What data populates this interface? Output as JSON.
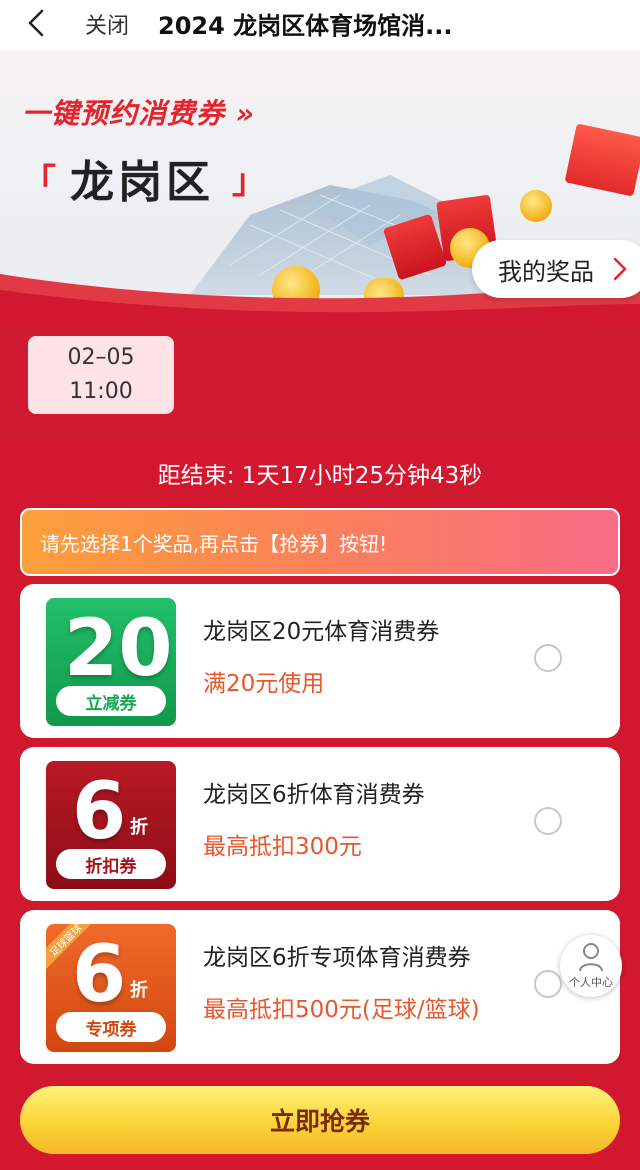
{
  "nav": {
    "close_label": "关闭",
    "title": "2024 龙岗区体育场馆消..."
  },
  "banner": {
    "slogan": "一键预约消费券 »",
    "bracket_left": "「",
    "district": "龙岗区",
    "bracket_right": "」",
    "my_prizes_label": "我的奖品"
  },
  "date_tab": {
    "date": "02–05",
    "time": "11:00"
  },
  "countdown": "距结束: 1天17小时25分钟43秒",
  "tip": "请先选择1个奖品,再点击【抢券】按钮!",
  "coupons": [
    {
      "thumb_number": "20",
      "thumb_tag": "立减券",
      "name": "龙岗区20元体育消费券",
      "desc": "满20元使用",
      "color": "#17a752"
    },
    {
      "thumb_number": "6",
      "thumb_unit": "折",
      "thumb_tag": "折扣券",
      "name": "龙岗区6折体育消费券",
      "desc": "最高抵扣300元",
      "color": "#a4131d"
    },
    {
      "thumb_number": "6",
      "thumb_unit": "折",
      "thumb_tag": "专项券",
      "thumb_ribbon": "足球篮球",
      "name": "龙岗区6折专项体育消费券",
      "desc": "最高抵扣500元(足球/篮球)",
      "color": "#e0541b"
    }
  ],
  "user_center_label": "个人中心",
  "grab_button": "立即抢券",
  "colors": {
    "page_bg": "#d2182e",
    "accent": "#e4232e",
    "desc_orange": "#e8572c",
    "button_yellow": "#fbd43a"
  },
  "icons": [
    "back-arrow-icon",
    "chevron-right-icon",
    "user-icon",
    "coin-icon",
    "red-envelope-icon"
  ]
}
